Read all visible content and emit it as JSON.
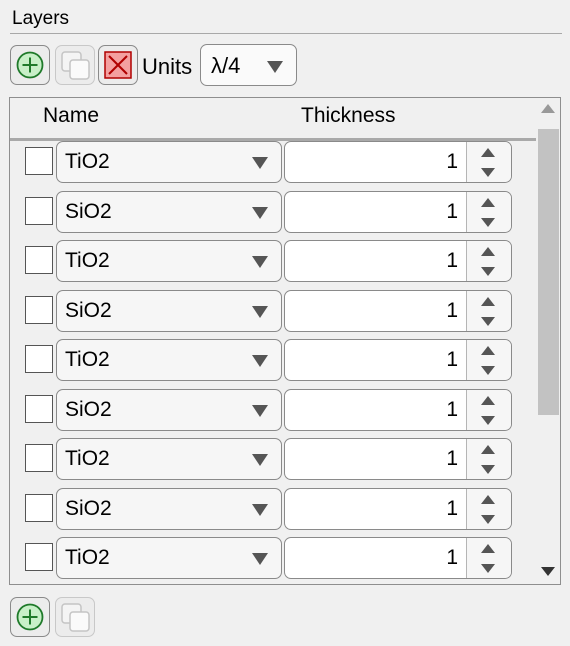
{
  "panel": {
    "title": "Layers"
  },
  "toolbar": {
    "units_label": "Units",
    "units_value": "λ/4"
  },
  "table": {
    "columns": [
      "Name",
      "Thickness"
    ],
    "rows": [
      {
        "material": "TiO2",
        "thickness": "1",
        "checked": false
      },
      {
        "material": "SiO2",
        "thickness": "1",
        "checked": false
      },
      {
        "material": "TiO2",
        "thickness": "1",
        "checked": false
      },
      {
        "material": "SiO2",
        "thickness": "1",
        "checked": false
      },
      {
        "material": "TiO2",
        "thickness": "1",
        "checked": false
      },
      {
        "material": "SiO2",
        "thickness": "1",
        "checked": false
      },
      {
        "material": "TiO2",
        "thickness": "1",
        "checked": false
      },
      {
        "material": "SiO2",
        "thickness": "1",
        "checked": false
      },
      {
        "material": "TiO2",
        "thickness": "1",
        "checked": false
      }
    ]
  },
  "colors": {
    "add_green": "#c8f0c8",
    "delete_red": "#f4a0a0"
  },
  "icons": {
    "add": "plus-circle-icon",
    "duplicate": "duplicate-icon",
    "delete": "delete-x-icon",
    "dropdown": "triangle-down-icon",
    "spin_up": "triangle-up-icon",
    "spin_down": "triangle-down-icon"
  }
}
